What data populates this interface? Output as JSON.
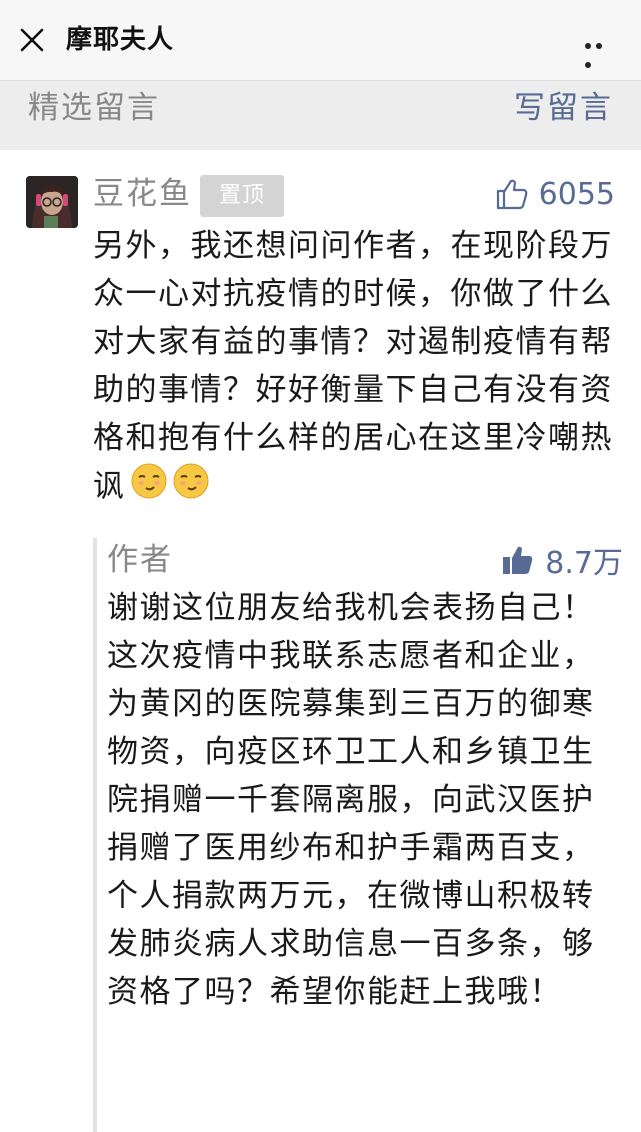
{
  "header": {
    "title": "摩耶夫人",
    "close_icon": "close-icon",
    "more_icon": "more-icon"
  },
  "section": {
    "title": "精选留言",
    "write_label": "写留言"
  },
  "comment": {
    "nickname": "豆花鱼",
    "pinned_label": "置顶",
    "likes": "6055",
    "text": "另外，我还想问问作者，在现阶段万众一心对抗疫情的时候，你做了什么对大家有益的事情？对遏制疫情有帮助的事情？好好衡量下自己有没有资格和抱有什么样的居心在这里冷嘲热讽",
    "emoji_icon": "smirk-emoji-icon",
    "reply": {
      "author": "作者",
      "likes": "8.7万",
      "text": "谢谢这位朋友给我机会表扬自己！这次疫情中我联系志愿者和企业，为黄冈的医院募集到三百万的御寒物资，向疫区环卫工人和乡镇卫生院捐赠一千套隔离服，向武汉医护捐赠了医用纱布和护手霜两百支，个人捐款两万元，在微博山积极转发肺炎病人求助信息一百多条，够资格了吗？希望你能赶上我哦！"
    }
  },
  "colors": {
    "link": "#576b95",
    "muted": "#888888",
    "background": "#ededed"
  }
}
